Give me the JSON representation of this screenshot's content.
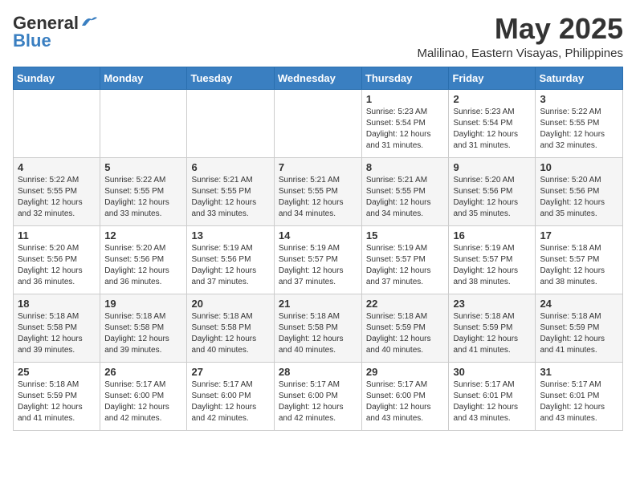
{
  "logo": {
    "general": "General",
    "blue": "Blue"
  },
  "title": {
    "month_year": "May 2025",
    "location": "Malilinao, Eastern Visayas, Philippines"
  },
  "weekdays": [
    "Sunday",
    "Monday",
    "Tuesday",
    "Wednesday",
    "Thursday",
    "Friday",
    "Saturday"
  ],
  "weeks": [
    [
      {
        "day": "",
        "info": ""
      },
      {
        "day": "",
        "info": ""
      },
      {
        "day": "",
        "info": ""
      },
      {
        "day": "",
        "info": ""
      },
      {
        "day": "1",
        "info": "Sunrise: 5:23 AM\nSunset: 5:54 PM\nDaylight: 12 hours\nand 31 minutes."
      },
      {
        "day": "2",
        "info": "Sunrise: 5:23 AM\nSunset: 5:54 PM\nDaylight: 12 hours\nand 31 minutes."
      },
      {
        "day": "3",
        "info": "Sunrise: 5:22 AM\nSunset: 5:55 PM\nDaylight: 12 hours\nand 32 minutes."
      }
    ],
    [
      {
        "day": "4",
        "info": "Sunrise: 5:22 AM\nSunset: 5:55 PM\nDaylight: 12 hours\nand 32 minutes."
      },
      {
        "day": "5",
        "info": "Sunrise: 5:22 AM\nSunset: 5:55 PM\nDaylight: 12 hours\nand 33 minutes."
      },
      {
        "day": "6",
        "info": "Sunrise: 5:21 AM\nSunset: 5:55 PM\nDaylight: 12 hours\nand 33 minutes."
      },
      {
        "day": "7",
        "info": "Sunrise: 5:21 AM\nSunset: 5:55 PM\nDaylight: 12 hours\nand 34 minutes."
      },
      {
        "day": "8",
        "info": "Sunrise: 5:21 AM\nSunset: 5:55 PM\nDaylight: 12 hours\nand 34 minutes."
      },
      {
        "day": "9",
        "info": "Sunrise: 5:20 AM\nSunset: 5:56 PM\nDaylight: 12 hours\nand 35 minutes."
      },
      {
        "day": "10",
        "info": "Sunrise: 5:20 AM\nSunset: 5:56 PM\nDaylight: 12 hours\nand 35 minutes."
      }
    ],
    [
      {
        "day": "11",
        "info": "Sunrise: 5:20 AM\nSunset: 5:56 PM\nDaylight: 12 hours\nand 36 minutes."
      },
      {
        "day": "12",
        "info": "Sunrise: 5:20 AM\nSunset: 5:56 PM\nDaylight: 12 hours\nand 36 minutes."
      },
      {
        "day": "13",
        "info": "Sunrise: 5:19 AM\nSunset: 5:56 PM\nDaylight: 12 hours\nand 37 minutes."
      },
      {
        "day": "14",
        "info": "Sunrise: 5:19 AM\nSunset: 5:57 PM\nDaylight: 12 hours\nand 37 minutes."
      },
      {
        "day": "15",
        "info": "Sunrise: 5:19 AM\nSunset: 5:57 PM\nDaylight: 12 hours\nand 37 minutes."
      },
      {
        "day": "16",
        "info": "Sunrise: 5:19 AM\nSunset: 5:57 PM\nDaylight: 12 hours\nand 38 minutes."
      },
      {
        "day": "17",
        "info": "Sunrise: 5:18 AM\nSunset: 5:57 PM\nDaylight: 12 hours\nand 38 minutes."
      }
    ],
    [
      {
        "day": "18",
        "info": "Sunrise: 5:18 AM\nSunset: 5:58 PM\nDaylight: 12 hours\nand 39 minutes."
      },
      {
        "day": "19",
        "info": "Sunrise: 5:18 AM\nSunset: 5:58 PM\nDaylight: 12 hours\nand 39 minutes."
      },
      {
        "day": "20",
        "info": "Sunrise: 5:18 AM\nSunset: 5:58 PM\nDaylight: 12 hours\nand 40 minutes."
      },
      {
        "day": "21",
        "info": "Sunrise: 5:18 AM\nSunset: 5:58 PM\nDaylight: 12 hours\nand 40 minutes."
      },
      {
        "day": "22",
        "info": "Sunrise: 5:18 AM\nSunset: 5:59 PM\nDaylight: 12 hours\nand 40 minutes."
      },
      {
        "day": "23",
        "info": "Sunrise: 5:18 AM\nSunset: 5:59 PM\nDaylight: 12 hours\nand 41 minutes."
      },
      {
        "day": "24",
        "info": "Sunrise: 5:18 AM\nSunset: 5:59 PM\nDaylight: 12 hours\nand 41 minutes."
      }
    ],
    [
      {
        "day": "25",
        "info": "Sunrise: 5:18 AM\nSunset: 5:59 PM\nDaylight: 12 hours\nand 41 minutes."
      },
      {
        "day": "26",
        "info": "Sunrise: 5:17 AM\nSunset: 6:00 PM\nDaylight: 12 hours\nand 42 minutes."
      },
      {
        "day": "27",
        "info": "Sunrise: 5:17 AM\nSunset: 6:00 PM\nDaylight: 12 hours\nand 42 minutes."
      },
      {
        "day": "28",
        "info": "Sunrise: 5:17 AM\nSunset: 6:00 PM\nDaylight: 12 hours\nand 42 minutes."
      },
      {
        "day": "29",
        "info": "Sunrise: 5:17 AM\nSunset: 6:00 PM\nDaylight: 12 hours\nand 43 minutes."
      },
      {
        "day": "30",
        "info": "Sunrise: 5:17 AM\nSunset: 6:01 PM\nDaylight: 12 hours\nand 43 minutes."
      },
      {
        "day": "31",
        "info": "Sunrise: 5:17 AM\nSunset: 6:01 PM\nDaylight: 12 hours\nand 43 minutes."
      }
    ]
  ]
}
